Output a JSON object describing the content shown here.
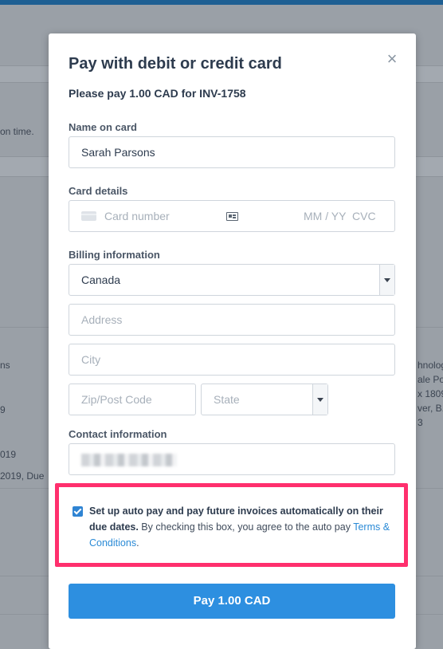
{
  "background": {
    "snippets": [
      "on time.",
      "ns",
      "9",
      "019",
      "2019, Due",
      "hnolog",
      "ale Pos",
      "x 1809",
      "ver, B.",
      "3"
    ]
  },
  "modal": {
    "title": "Pay with debit or credit card",
    "close_icon": "close-icon",
    "subtitle": "Please pay 1.00 CAD for INV-1758",
    "name": {
      "label": "Name on card",
      "value": "Sarah Parsons"
    },
    "card": {
      "label": "Card details",
      "number_placeholder": "Card number",
      "expiry_placeholder": "MM / YY",
      "cvc_placeholder": "CVC"
    },
    "billing": {
      "label": "Billing information",
      "country": "Canada",
      "address_placeholder": "Address",
      "city_placeholder": "City",
      "zip_placeholder": "Zip/Post Code",
      "state_placeholder": "State"
    },
    "contact": {
      "label": "Contact information"
    },
    "autopay": {
      "checked": true,
      "bold_text": "Set up auto pay and pay future invoices automatically on their due dates.",
      "text": " By checking this box, you agree to the auto pay ",
      "link": "Terms & Conditions",
      "end": "."
    },
    "pay_button": "Pay 1.00 CAD"
  },
  "colors": {
    "accent": "#2d8fe0",
    "highlight_border": "#ff2f6d",
    "overlay": "#9aa0a7"
  }
}
